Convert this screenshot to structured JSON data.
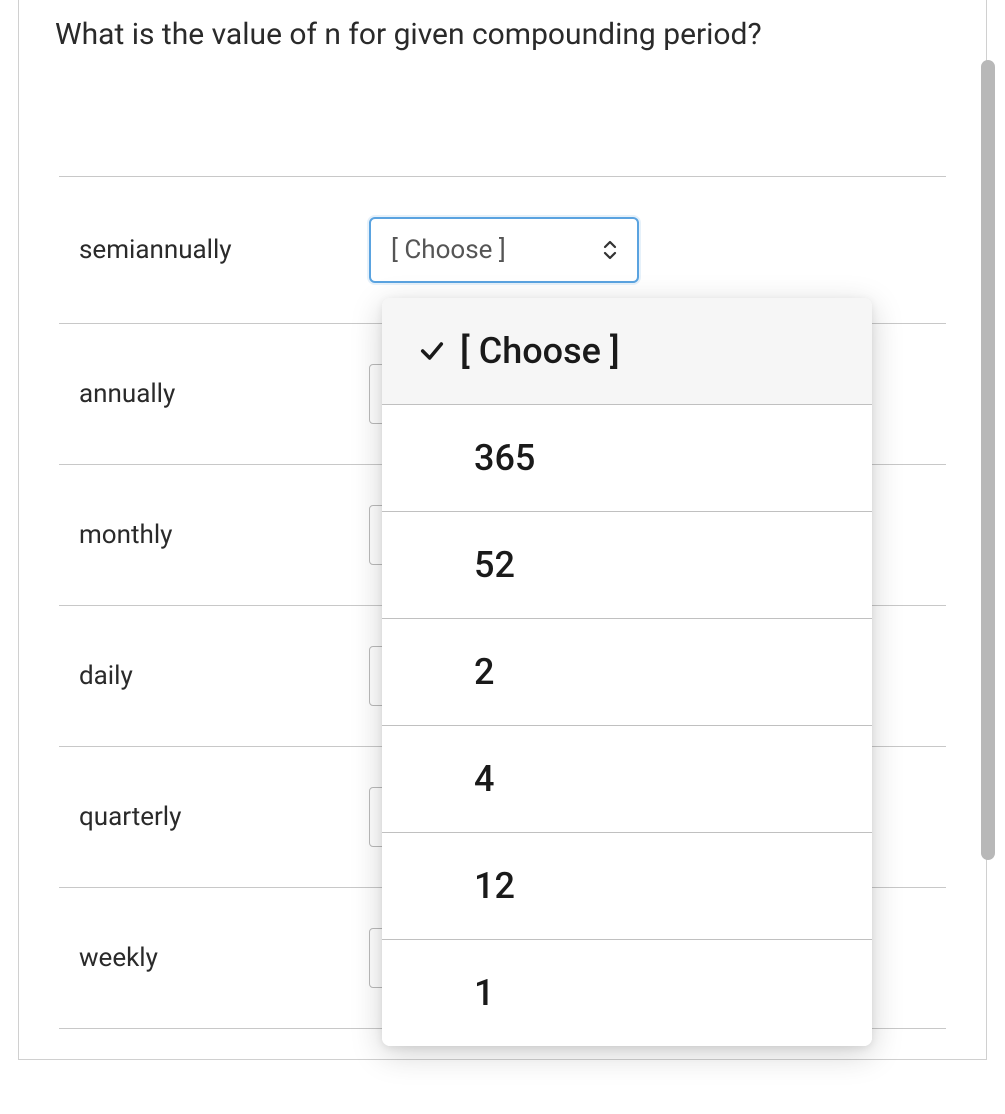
{
  "question": "What is the value of n for given compounding period?",
  "select_placeholder": "[ Choose ]",
  "rows": [
    {
      "label": "semiannually"
    },
    {
      "label": "annually"
    },
    {
      "label": "monthly"
    },
    {
      "label": "daily"
    },
    {
      "label": "quarterly"
    },
    {
      "label": "weekly"
    }
  ],
  "dropdown": {
    "options": [
      {
        "label": "[ Choose ]",
        "selected": true
      },
      {
        "label": "365",
        "selected": false
      },
      {
        "label": "52",
        "selected": false
      },
      {
        "label": "2",
        "selected": false
      },
      {
        "label": "4",
        "selected": false
      },
      {
        "label": "12",
        "selected": false
      },
      {
        "label": "1",
        "selected": false
      }
    ]
  }
}
